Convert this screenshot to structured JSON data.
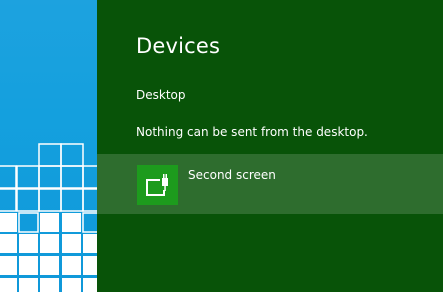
{
  "charm": {
    "title": "Devices",
    "app_name": "Desktop",
    "message": "Nothing can be sent from the desktop.",
    "devices": [
      {
        "label": "Second screen",
        "icon": "second-screen-icon"
      }
    ]
  },
  "colors": {
    "charm_background": "#085308",
    "selected_item": "#2e6d2e",
    "device_tile": "#1d9b1d",
    "start_background": "#1da2df"
  }
}
